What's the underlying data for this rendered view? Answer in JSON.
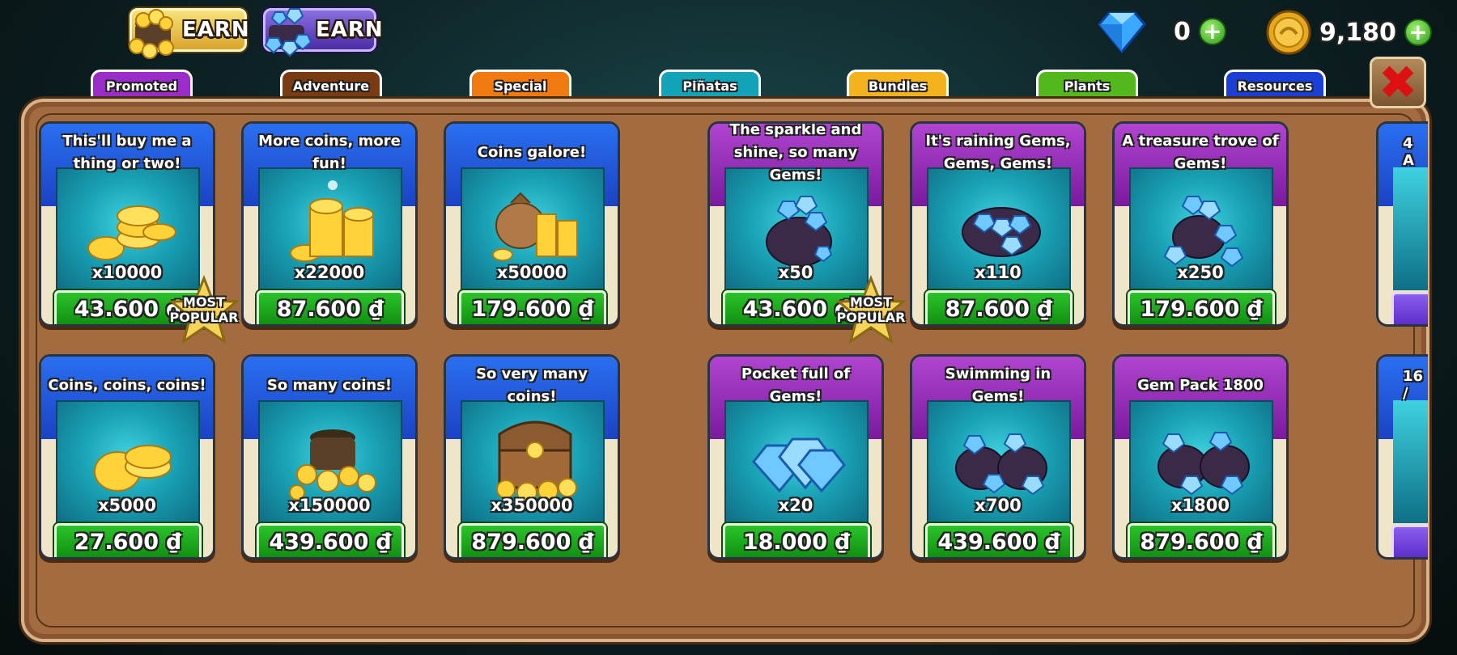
{
  "header": {
    "earn_coins_label": "EARN",
    "earn_gems_label": "EARN",
    "gems_count": "0",
    "coins_count": "9,180",
    "plus_symbol": "+"
  },
  "tabs": [
    {
      "label": "Promoted",
      "color": "#9b2cc8"
    },
    {
      "label": "Adventure",
      "color": "#7a3a12"
    },
    {
      "label": "Special",
      "color": "#f07a10"
    },
    {
      "label": "Piñatas",
      "color": "#13a3b8"
    },
    {
      "label": "Bundles",
      "color": "#f4b21c"
    },
    {
      "label": "Plants",
      "color": "#52b81c"
    },
    {
      "label": "Resources",
      "color": "#1a3fd6",
      "active": true
    }
  ],
  "close_symbol": "✖",
  "popular_label": "MOST POPULAR",
  "coin_packs": [
    {
      "title": "This'll buy me a thing or two!",
      "qty": "x10000",
      "price": "43.600 ₫",
      "popular": true
    },
    {
      "title": "More coins, more fun!",
      "qty": "x22000",
      "price": "87.600 ₫"
    },
    {
      "title": "Coins galore!",
      "qty": "x50000",
      "price": "179.600 ₫"
    },
    {
      "title": "Coins, coins, coins!",
      "qty": "x5000",
      "price": "27.600 ₫"
    },
    {
      "title": "So many coins!",
      "qty": "x150000",
      "price": "439.600 ₫"
    },
    {
      "title": "So very many coins!",
      "qty": "x350000",
      "price": "879.600 ₫"
    }
  ],
  "gem_packs": [
    {
      "title": "The sparkle and shine, so many Gems!",
      "qty": "x50",
      "price": "43.600 ₫",
      "popular": true
    },
    {
      "title": "It's raining Gems, Gems, Gems!",
      "qty": "x110",
      "price": "87.600 ₫"
    },
    {
      "title": "A treasure trove of Gems!",
      "qty": "x250",
      "price": "179.600 ₫"
    },
    {
      "title": "Pocket full of Gems!",
      "qty": "x20",
      "price": "18.000 ₫"
    },
    {
      "title": "Swimming in Gems!",
      "qty": "x700",
      "price": "439.600 ₫"
    },
    {
      "title": "Gem Pack 1800",
      "qty": "x1800",
      "price": "879.600 ₫"
    }
  ],
  "edge_cards": [
    {
      "title": "4 A"
    },
    {
      "title": "16 /"
    }
  ]
}
